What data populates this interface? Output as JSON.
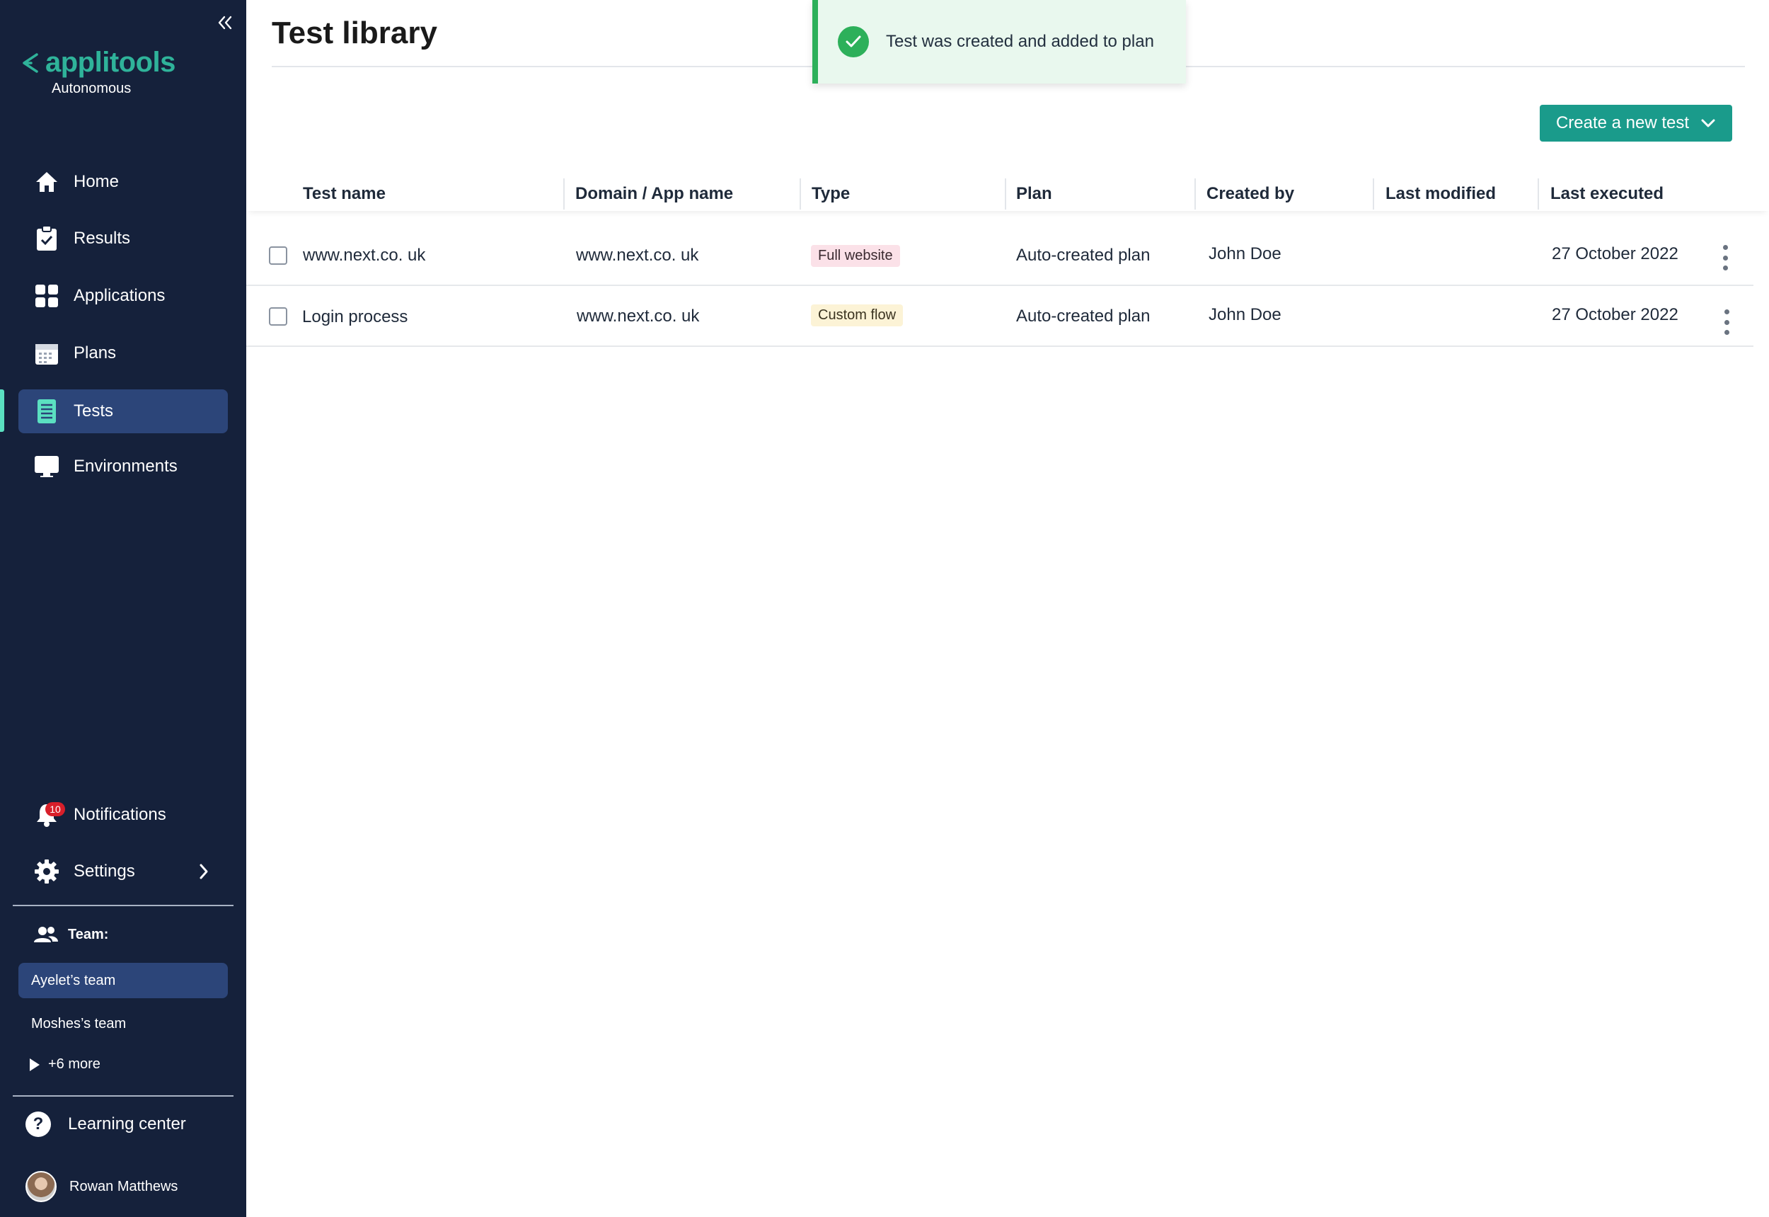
{
  "sidebar": {
    "logo_word": "applitools",
    "logo_sub": "Autonomous",
    "nav": [
      {
        "label": "Home",
        "icon": "home-icon"
      },
      {
        "label": "Results",
        "icon": "clipboard-check-icon"
      },
      {
        "label": "Applications",
        "icon": "grid-icon"
      },
      {
        "label": "Plans",
        "icon": "calendar-icon"
      },
      {
        "label": "Tests",
        "icon": "test-list-icon",
        "active": true
      },
      {
        "label": "Environments",
        "icon": "monitor-icon"
      }
    ],
    "notifications": {
      "label": "Notifications",
      "count": "10"
    },
    "settings": {
      "label": "Settings"
    },
    "team": {
      "label": "Team:",
      "items": [
        {
          "label": "Ayelet’s team",
          "active": true
        },
        {
          "label": "Moshes’s team"
        }
      ],
      "more": "+6 more"
    },
    "learning": "Learning center",
    "user": "Rowan Matthews"
  },
  "main": {
    "title": "Test library",
    "toast": "Test  was created and added to plan",
    "create_button": "Create a new test",
    "columns": [
      "Test name",
      "Domain / App name",
      "Type",
      "Plan",
      "Created by",
      "Last modified",
      "Last executed"
    ],
    "rows": [
      {
        "name": "www.next.co. uk",
        "domain": "www.next.co. uk",
        "type": "Full website",
        "plan": "Auto-created plan",
        "created_by": "John Doe",
        "last_modified": "",
        "last_executed": "27  October 2022"
      },
      {
        "name": "Login process",
        "domain": "www.next.co. uk",
        "type": "Custom flow",
        "plan": "Auto-created plan",
        "created_by": "John Doe",
        "last_modified": "",
        "last_executed": "27  October 2022"
      }
    ]
  },
  "colors": {
    "sidebar_bg": "#15213b",
    "active_nav": "#2c4579",
    "brand": "#2fb39a",
    "button": "#1a9b8b",
    "toast_bg": "#e9f8ee",
    "success": "#2db05a",
    "tag_full_website": "#fbe1e8",
    "tag_custom_flow": "#fcf3d6"
  }
}
